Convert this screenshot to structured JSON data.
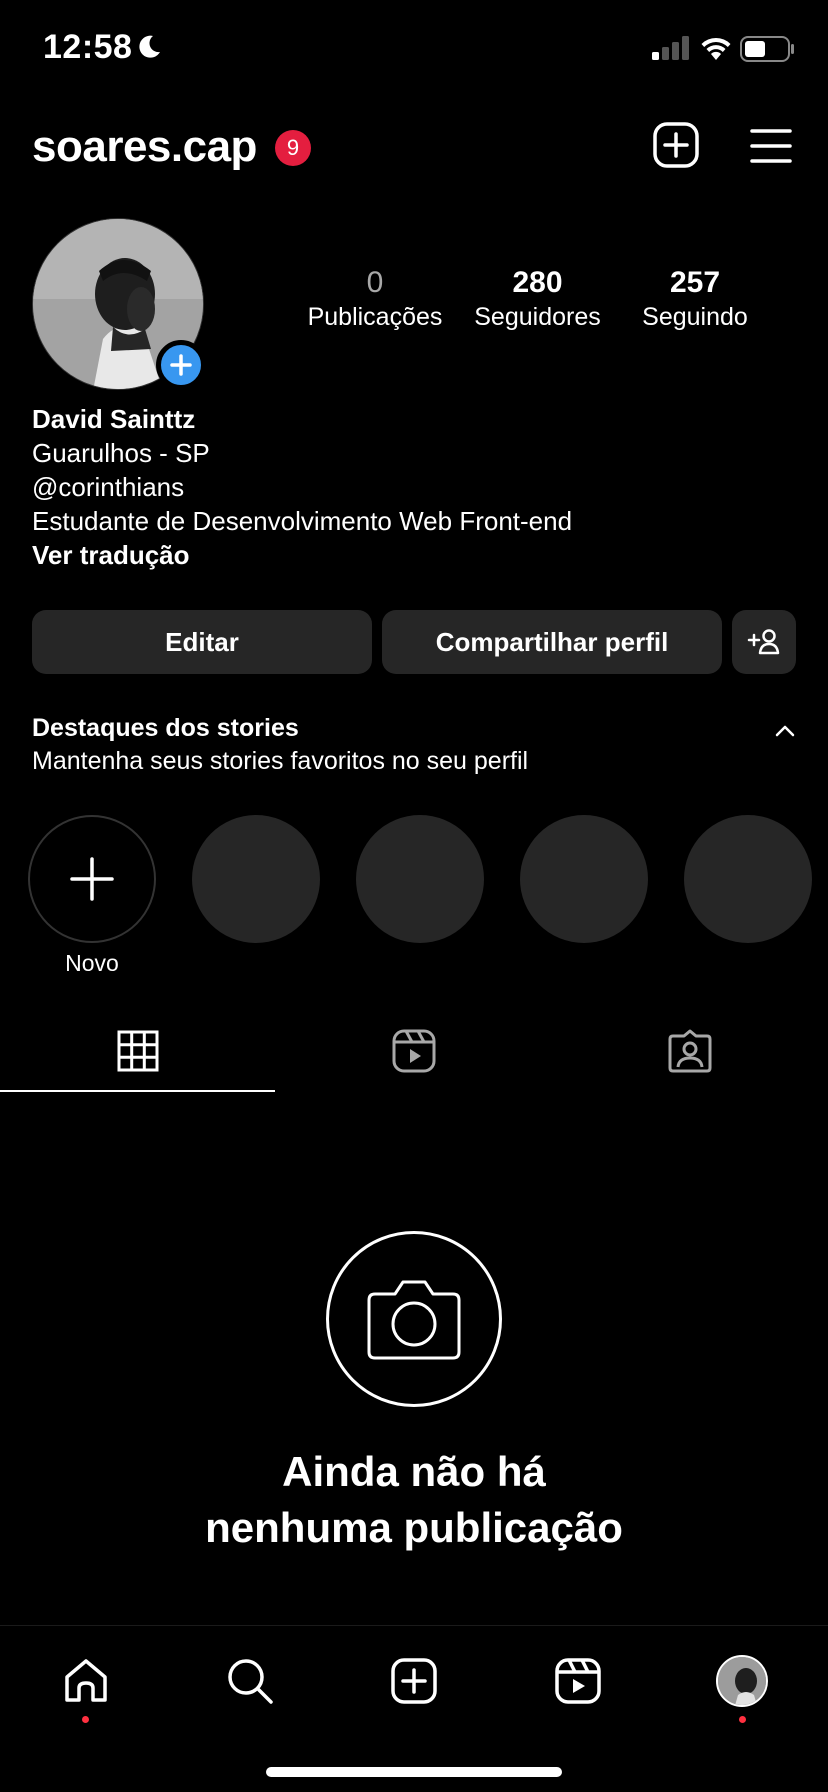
{
  "status_bar": {
    "time": "12:58",
    "icons": [
      "moon-icon",
      "cellular-signal-icon",
      "wifi-icon",
      "battery-icon"
    ]
  },
  "header": {
    "username": "soares.cap",
    "notification_count": "9",
    "icons": [
      "add-post-icon",
      "hamburger-menu-icon"
    ]
  },
  "profile": {
    "stats": [
      {
        "value": "0",
        "label": "Publicações"
      },
      {
        "value": "280",
        "label": "Seguidores"
      },
      {
        "value": "257",
        "label": "Seguindo"
      }
    ],
    "name": "David Sainttz",
    "location": "Guarulhos - SP",
    "mention": "@corinthians",
    "bio": "Estudante de Desenvolvimento Web Front-end",
    "translate_link": "Ver tradução"
  },
  "actions": {
    "edit_label": "Editar",
    "share_label": "Compartilhar perfil"
  },
  "highlights": {
    "title": "Destaques dos stories",
    "subtitle": "Mantenha seus stories favoritos no seu perfil",
    "new_label": "Novo"
  },
  "tabs": [
    "grid-icon",
    "reels-icon",
    "tagged-icon"
  ],
  "empty_state": {
    "line1": "Ainda não há",
    "line2": "nenhuma publicação"
  },
  "bottom_nav": [
    "home-icon",
    "search-icon",
    "create-icon",
    "reels-icon",
    "profile-avatar"
  ],
  "colors": {
    "background": "#000000",
    "button": "#262626",
    "badge": "#e41e3f",
    "accent_blue": "#3897f0",
    "dot_red": "#ff3040"
  }
}
